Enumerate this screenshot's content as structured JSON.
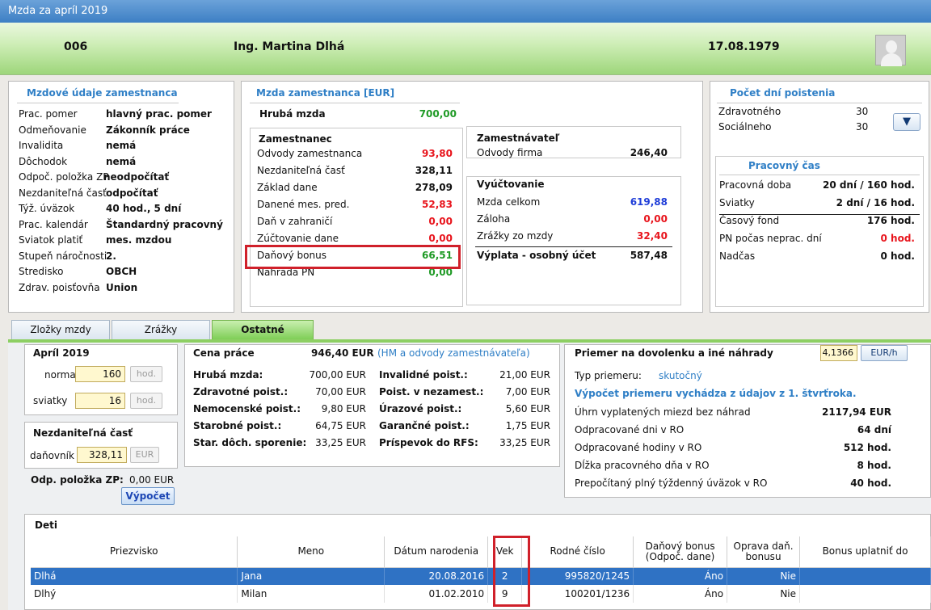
{
  "window": {
    "title": "Mzda za apríl 2019"
  },
  "header": {
    "number": "006",
    "name": "Ing. Martina Dlhá",
    "birth_date": "17.08.1979"
  },
  "employee_data": {
    "title": "Mzdové údaje zamestnanca",
    "rows": [
      {
        "label": "Prac. pomer",
        "value": "hlavný prac. pomer"
      },
      {
        "label": "Odmeňovanie",
        "value": "Zákonník práce"
      },
      {
        "label": "Invalidita",
        "value": "nemá"
      },
      {
        "label": "Dôchodok",
        "value": "nemá"
      },
      {
        "label": "Odpoč. položka ZP",
        "value": "neodpočítať"
      },
      {
        "label": "Nezdaniteľná časť",
        "value": "odpočítať"
      },
      {
        "label": "Týž. úväzok",
        "value": "40 hod., 5 dní"
      },
      {
        "label": "Prac. kalendár",
        "value": "Štandardný pracovný"
      },
      {
        "label": "Sviatok platiť",
        "value": "mes. mzdou"
      },
      {
        "label": "Stupeň náročnosti",
        "value": "2."
      },
      {
        "label": "Stredisko",
        "value": "OBCH"
      },
      {
        "label": "Zdrav. poisťovňa",
        "value": "Union"
      }
    ]
  },
  "wage": {
    "title": "Mzda zamestnanca [EUR]",
    "gross_label": "Hrubá mzda",
    "gross_value": "700,00",
    "employee": {
      "title": "Zamestnanec",
      "rows": [
        {
          "label": "Odvody zamestnanca",
          "value": "93,80"
        },
        {
          "label": "Nezdaniteľná časť",
          "value": "328,11"
        },
        {
          "label": "Základ dane",
          "value": "278,09"
        },
        {
          "label": "Danené mes. pred.",
          "value": "52,83"
        },
        {
          "label": "Daň v zahraničí",
          "value": "0,00"
        },
        {
          "label": "Zúčtovanie dane",
          "value": "0,00"
        },
        {
          "label": "Daňový bonus",
          "value": "66,51"
        },
        {
          "label": "Náhrada PN",
          "value": "0,00"
        }
      ]
    },
    "employer": {
      "title": "Zamestnávateľ",
      "rows": [
        {
          "label": "Odvody firma",
          "value": "246,40"
        }
      ]
    },
    "settlement": {
      "title": "Vyúčtovanie",
      "rows": [
        {
          "label": "Mzda celkom",
          "value": "619,88"
        },
        {
          "label": "Záloha",
          "value": "0,00"
        },
        {
          "label": "Zrážky zo mzdy",
          "value": "32,40"
        }
      ],
      "payout_label": "Výplata - osobný účet",
      "payout_value": "587,48"
    }
  },
  "insurance_days": {
    "title": "Počet dní poistenia",
    "rows": [
      {
        "label": "Zdravotného",
        "value": "30"
      },
      {
        "label": "Sociálneho",
        "value": "30"
      }
    ]
  },
  "working_time": {
    "title": "Pracovný čas",
    "rows": [
      {
        "label": "Pracovná doba",
        "value": "20 dní / 160 hod."
      },
      {
        "label": "Sviatky",
        "value": "2 dní / 16 hod."
      },
      {
        "label": "Časový fond",
        "value": "176 hod."
      },
      {
        "label": "PN počas neprac. dní",
        "value": "0 hod."
      },
      {
        "label": "Nadčas",
        "value": "0 hod."
      }
    ]
  },
  "tabs": [
    {
      "label": "Zložky mzdy"
    },
    {
      "label": "Zrážky"
    },
    {
      "label": "Ostatné"
    }
  ],
  "month": {
    "title": "Apríl 2019",
    "norma_label": "norma",
    "norma_value": "160",
    "norma_unit": "hod.",
    "holidays_label": "sviatky",
    "holidays_value": "16",
    "holidays_unit": "hod."
  },
  "nontaxable": {
    "title": "Nezdaniteľná časť",
    "label": "daňovník",
    "value": "328,11",
    "unit": "EUR"
  },
  "deduction": {
    "label": "Odp. položka ZP:",
    "value": "0,00 EUR",
    "button": "Výpočet"
  },
  "labor_cost": {
    "label": "Cena práce",
    "value": "946,40 EUR",
    "note": "(HM a odvody zamestnávateľa)",
    "left": [
      {
        "label": "Hrubá mzda:",
        "value": "700,00 EUR"
      },
      {
        "label": "Zdravotné poist.:",
        "value": "70,00 EUR"
      },
      {
        "label": "Nemocenské poist.:",
        "value": "9,80 EUR"
      },
      {
        "label": "Starobné poist.:",
        "value": "64,75 EUR"
      },
      {
        "label": "Star. dôch. sporenie:",
        "value": "33,25 EUR"
      }
    ],
    "right": [
      {
        "label": "Invalidné poist.:",
        "value": "21,00 EUR"
      },
      {
        "label": "Poist. v nezamest.:",
        "value": "7,00 EUR"
      },
      {
        "label": "Úrazové poist.:",
        "value": "5,60 EUR"
      },
      {
        "label": "Garančné poist.:",
        "value": "1,75 EUR"
      },
      {
        "label": "Príspevok do RFS:",
        "value": "33,25 EUR"
      }
    ]
  },
  "average": {
    "title": "Priemer na dovolenku a iné náhrady",
    "rate": "4,1366",
    "rate_unit": "EUR/h",
    "type_label": "Typ priemeru:",
    "type_value": "skutočný",
    "note": "Výpočet priemeru vychádza z údajov z 1. štvrťroka.",
    "rows": [
      {
        "label": "Úhrn vyplatených miezd bez náhrad",
        "value": "2117,94 EUR"
      },
      {
        "label": "Odpracované dni v RO",
        "value": "64 dní"
      },
      {
        "label": "Odpracované hodiny v RO",
        "value": "512 hod."
      },
      {
        "label": "Dĺžka pracovného dňa v RO",
        "value": "8 hod."
      },
      {
        "label": "Prepočítaný plný týždenný úväzok v RO",
        "value": "40 hod."
      }
    ]
  },
  "children": {
    "title": "Deti",
    "columns": [
      "Priezvisko",
      "Meno",
      "Dátum narodenia",
      "Vek",
      "Rodné číslo",
      "Daňový bonus (Odpoč. dane)",
      "Oprava daň. bonusu",
      "Bonus uplatniť do"
    ],
    "rows": [
      [
        "Dlhá",
        "Jana",
        "20.08.2016",
        "2",
        "995820/1245",
        "Áno",
        "Nie",
        ""
      ],
      [
        "Dlhý",
        "Milan",
        "01.02.2010",
        "9",
        "100201/1236",
        "Áno",
        "Nie",
        ""
      ]
    ]
  }
}
